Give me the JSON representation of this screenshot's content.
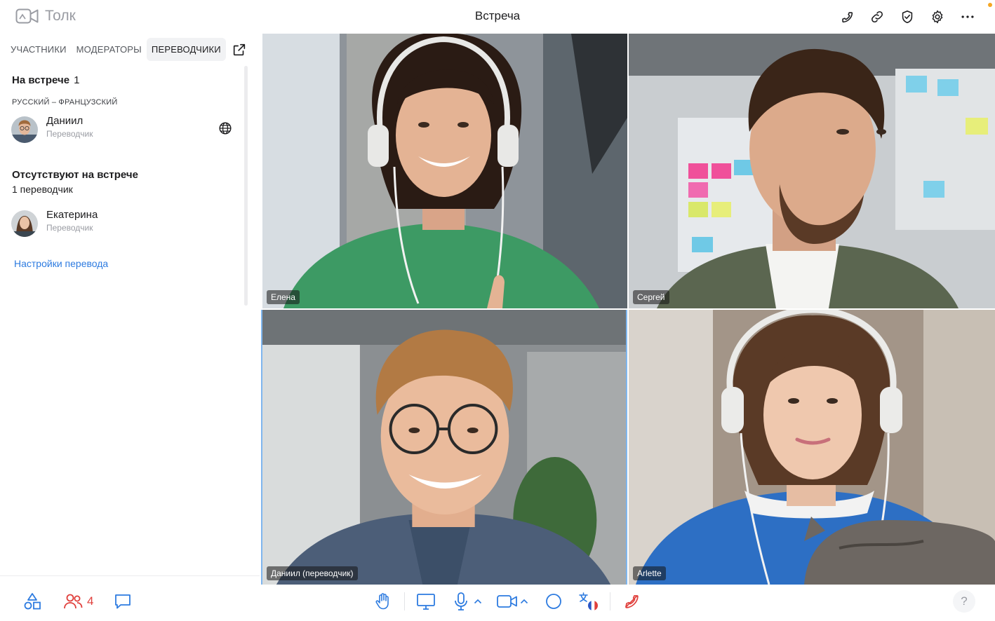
{
  "app": {
    "name": "Толк",
    "title": "Встреча"
  },
  "colors": {
    "accent": "#2e8ae6",
    "link": "#2d7be0",
    "danger": "#e0403c",
    "notification": "#f5a623"
  },
  "topbar_icons": [
    "phone-icon",
    "link-icon",
    "shield-check-icon",
    "gear-icon",
    "more-icon"
  ],
  "sidebar": {
    "tabs": [
      {
        "label": "УЧАСТНИКИ"
      },
      {
        "label": "МОДЕРАТОРЫ"
      },
      {
        "label": "ПЕРЕВОДЧИКИ",
        "active": true
      }
    ],
    "present": {
      "title": "На встрече",
      "count": "1",
      "language_pair": "РУССКИЙ – ФРАНЦУЗСКИЙ",
      "people": [
        {
          "name": "Даниил",
          "role": "Переводчик"
        }
      ]
    },
    "absent": {
      "title": "Отсутствуют на встрече",
      "subtitle": "1 переводчик",
      "people": [
        {
          "name": "Екатерина",
          "role": "Переводчик"
        }
      ]
    },
    "settings_link": "Настройки перевода"
  },
  "tiles": [
    {
      "name": "Елена"
    },
    {
      "name": "Сергей"
    },
    {
      "name": "Даниил (переводчик)"
    },
    {
      "name": "Arlette"
    }
  ],
  "bottombar": {
    "participants_count": "4",
    "help": "?"
  }
}
